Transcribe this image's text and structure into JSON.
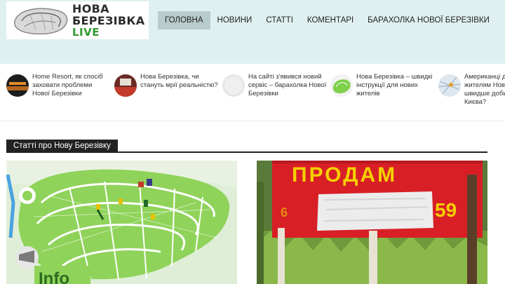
{
  "logo": {
    "line1": "НОВА",
    "line2": "БЕРЕЗІВКА",
    "live": "LIVE"
  },
  "nav": [
    {
      "label": "Головна",
      "active": true
    },
    {
      "label": "Новини",
      "active": false
    },
    {
      "label": "Статті",
      "active": false
    },
    {
      "label": "Коментарі",
      "active": false
    },
    {
      "label": "Барахолка Нової Березівки",
      "active": false
    }
  ],
  "ticker": [
    {
      "text": "Home Resort, як спосіб\nзаховати проблеми\nНової Березівки"
    },
    {
      "text": "Нова Березівка, чи\nстануть мрії реальністю?"
    },
    {
      "text": "На сайті з'явився новий\nсервіс – барахолка Нової\nБерезівки"
    },
    {
      "text": "Нова Березівка – швидкі\nінструкції для нових\nжителів"
    },
    {
      "text": "Американці д\nжителям Нов\nшвидше доби\nКиєва?"
    }
  ],
  "section": {
    "title": "Статті про Нову Березівку"
  },
  "cards": {
    "sign_text": "ПРОДАМ",
    "sign_number": "59",
    "info_fragment": "Info"
  },
  "colors": {
    "header_bg": "#dff0f0",
    "nav_active_bg": "#b8cccc",
    "logo_live": "#2f9a2f",
    "sign_red": "#d81f26",
    "sign_yellow": "#f5d000",
    "map_green": "#7ed04b"
  }
}
